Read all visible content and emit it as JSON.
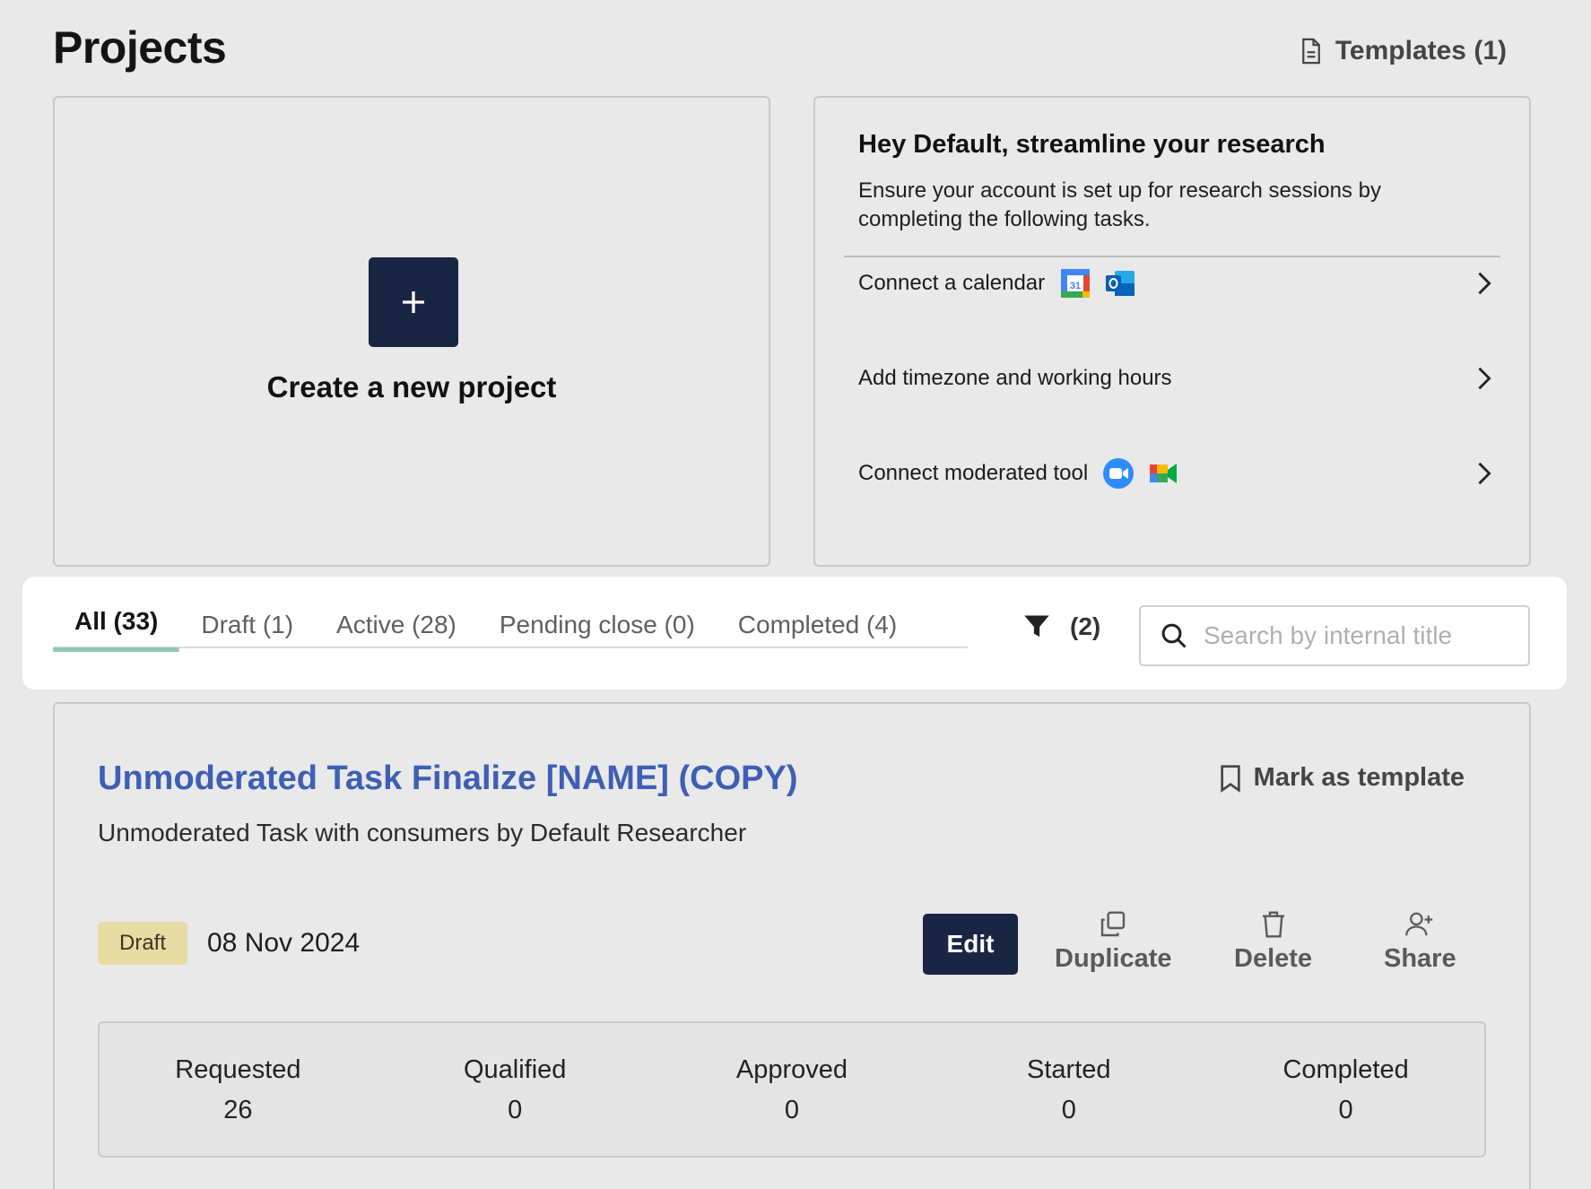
{
  "header": {
    "title": "Projects",
    "templates_label": "Templates (1)"
  },
  "create": {
    "label": "Create a new project"
  },
  "setup": {
    "title": "Hey Default, streamline your research",
    "description": "Ensure your account is set up for research sessions by completing the following tasks.",
    "tasks": [
      {
        "label": "Connect a calendar",
        "icons": [
          "google-calendar-icon",
          "outlook-icon"
        ]
      },
      {
        "label": "Add timezone and working hours",
        "icons": []
      },
      {
        "label": "Connect moderated tool",
        "icons": [
          "zoom-icon",
          "google-meet-icon"
        ]
      }
    ]
  },
  "tabs": [
    {
      "label": "All (33)",
      "active": true
    },
    {
      "label": "Draft (1)",
      "active": false
    },
    {
      "label": "Active (28)",
      "active": false
    },
    {
      "label": "Pending close (0)",
      "active": false
    },
    {
      "label": "Completed (4)",
      "active": false
    }
  ],
  "filter": {
    "count_label": "(2)"
  },
  "search": {
    "placeholder": "Search by internal title",
    "value": ""
  },
  "project": {
    "title": "Unmoderated Task Finalize [NAME] (COPY)",
    "subtitle": "Unmoderated Task with consumers by Default Researcher",
    "mark_template_label": "Mark as template",
    "status": "Draft",
    "date": "08 Nov 2024",
    "actions": {
      "edit": "Edit",
      "duplicate": "Duplicate",
      "delete": "Delete",
      "share": "Share"
    },
    "stats": [
      {
        "label": "Requested",
        "value": "26"
      },
      {
        "label": "Qualified",
        "value": "0"
      },
      {
        "label": "Approved",
        "value": "0"
      },
      {
        "label": "Started",
        "value": "0"
      },
      {
        "label": "Completed",
        "value": "0"
      }
    ]
  },
  "colors": {
    "primary": "#1a2544",
    "link": "#3e5fb5",
    "tab_indicator": "#8fc8b2",
    "draft_badge": "#e7dca2"
  }
}
